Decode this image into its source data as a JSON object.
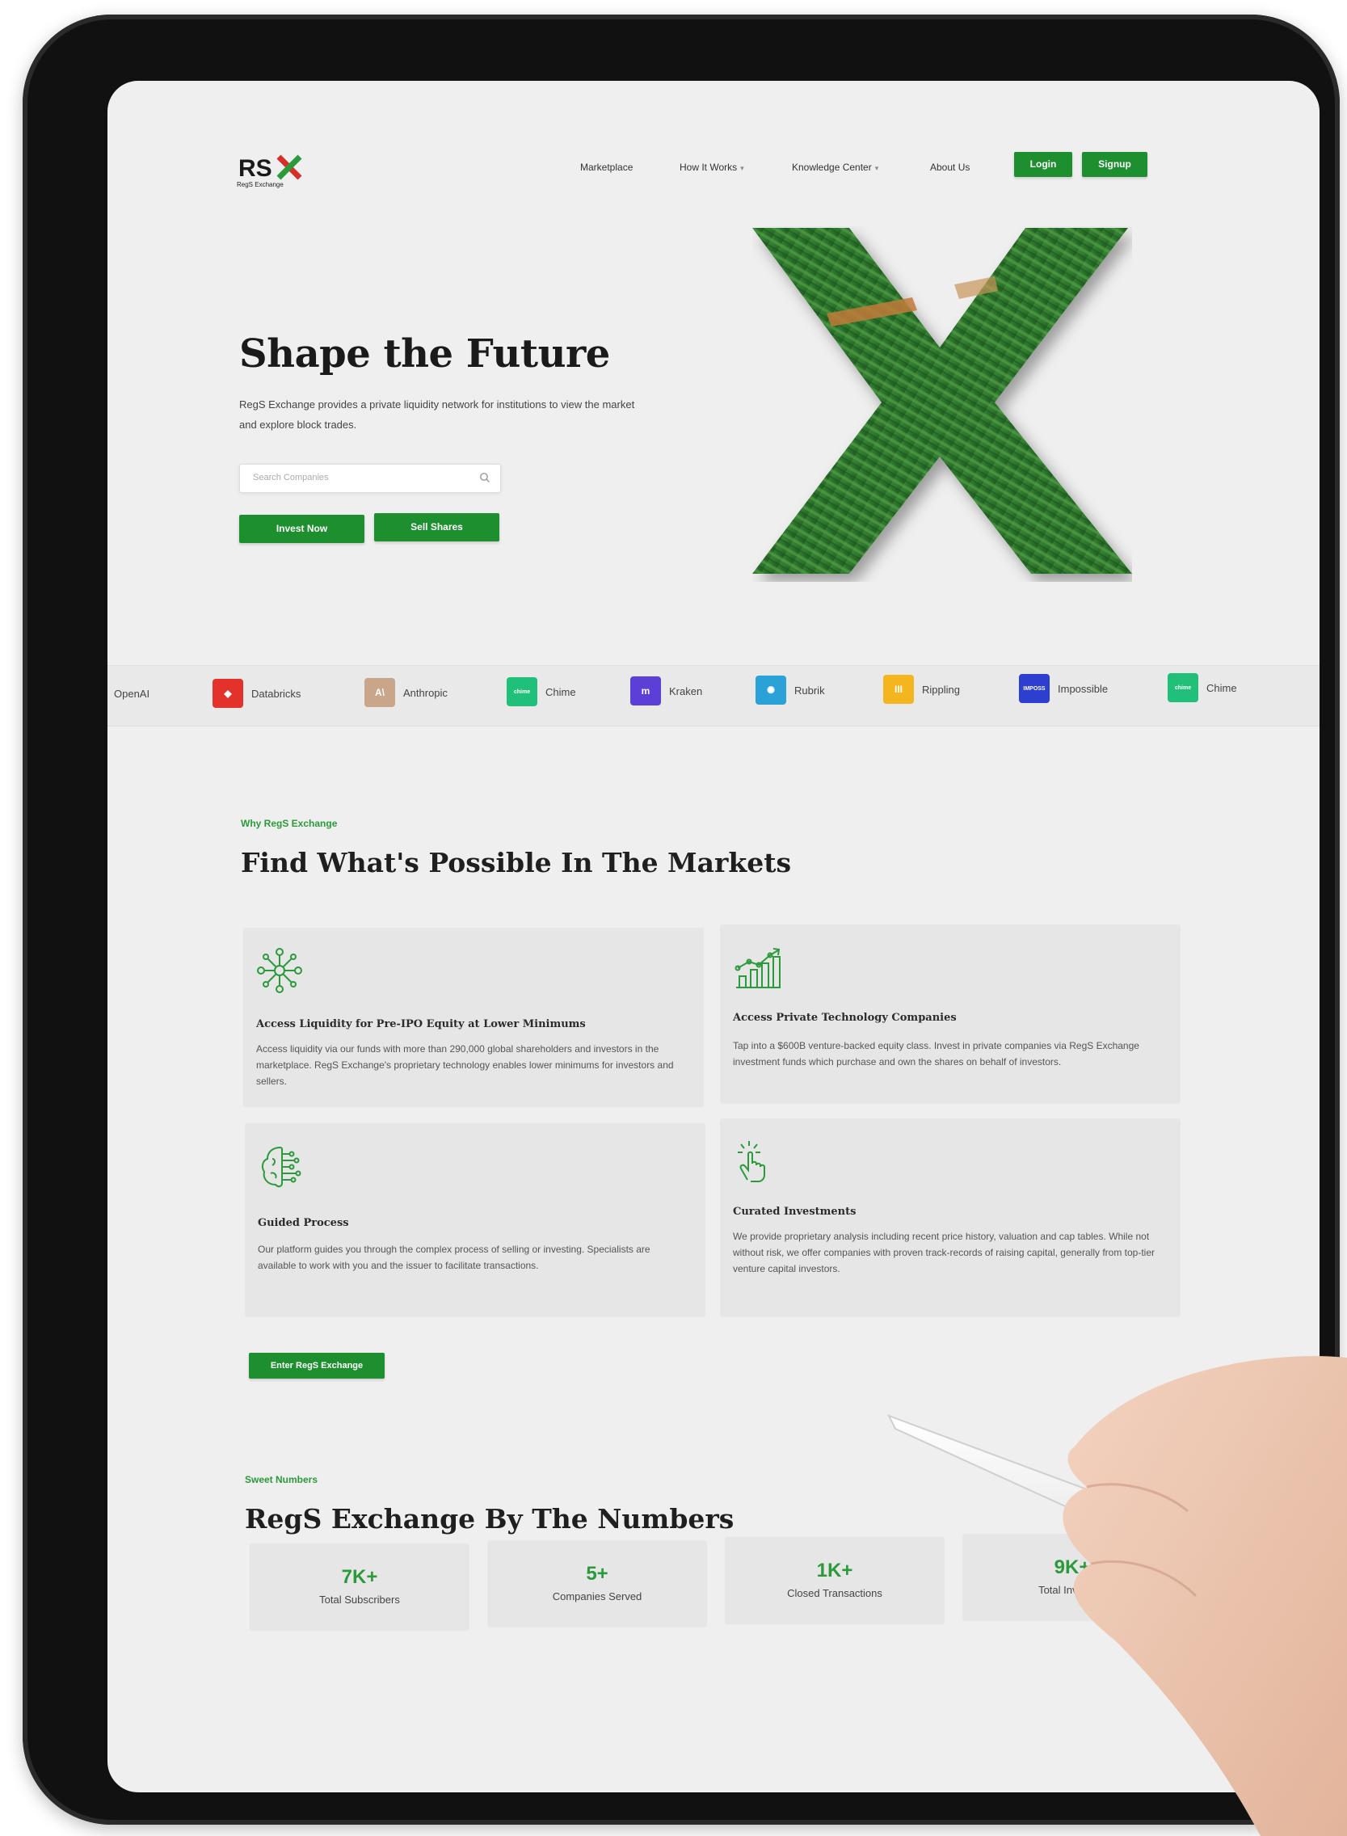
{
  "brand": {
    "logo_text": "RSX",
    "logo_subtitle": "RegS Exchange"
  },
  "nav": {
    "items": [
      "Marketplace",
      "How It Works",
      "Knowledge Center",
      "About Us"
    ],
    "login_label": "Login",
    "signup_label": "Signup"
  },
  "hero": {
    "title": "Shape the Future",
    "description": "RegS Exchange provides a private liquidity network for institutions to view the market and explore block trades.",
    "search_placeholder": "Search Companies",
    "invest_label": "Invest Now",
    "sell_label": "Sell Shares"
  },
  "companies": [
    {
      "name": "OpenAI",
      "badge": "",
      "color": "#e9e9e9"
    },
    {
      "name": "Databricks",
      "badge": "◆",
      "color": "#e2322b"
    },
    {
      "name": "Anthropic",
      "badge": "A\\",
      "color": "#c9a58a"
    },
    {
      "name": "Chime",
      "badge": "chime",
      "color": "#21c07a"
    },
    {
      "name": "Kraken",
      "badge": "m",
      "color": "#5b3fd6"
    },
    {
      "name": "Rubrik",
      "badge": "✺",
      "color": "#2aa2d8"
    },
    {
      "name": "Rippling",
      "badge": "III",
      "color": "#f5b51f"
    },
    {
      "name": "Impossible",
      "badge": "IMPOSS",
      "color": "#2c3fd1"
    },
    {
      "name": "Chime",
      "badge": "chime",
      "color": "#21c07a"
    }
  ],
  "why": {
    "eyebrow": "Why RegS Exchange",
    "title": "Find What's Possible In The Markets",
    "cards": [
      {
        "icon": "network-icon",
        "title": "Access Liquidity for Pre-IPO Equity at Lower Minimums",
        "body": "Access liquidity via our funds with more than 290,000 global shareholders and investors in the marketplace. RegS Exchange's proprietary technology enables lower minimums for investors and sellers."
      },
      {
        "icon": "growth-chart-icon",
        "title": "Access Private Technology Companies",
        "body": "Tap into a $600B venture-backed equity class. Invest in private companies via RegS Exchange investment funds which purchase and own the shares on behalf of investors."
      },
      {
        "icon": "brain-circuit-icon",
        "title": "Guided Process",
        "body": "Our platform guides you through the complex process of selling or investing. Specialists are available to work with you and the issuer to facilitate transactions."
      },
      {
        "icon": "tap-hand-icon",
        "title": "Curated Investments",
        "body": "We provide proprietary analysis including recent price history, valuation and cap tables. While not without risk, we offer companies with proven track-records of raising capital, generally from top-tier venture capital investors."
      }
    ],
    "cta_label": "Enter RegS Exchange"
  },
  "numbers": {
    "eyebrow": "Sweet Numbers",
    "title": "RegS Exchange By The Numbers",
    "stats": [
      {
        "value": "7K+",
        "label": "Total Subscribers"
      },
      {
        "value": "5+",
        "label": "Companies Served"
      },
      {
        "value": "1K+",
        "label": "Closed Transactions"
      },
      {
        "value": "9K+",
        "label": "Total Investors"
      }
    ]
  },
  "colors": {
    "accent": "#1d8f2f",
    "accent_text": "#2a9a3b",
    "screen_bg": "#efefef",
    "card_bg": "#e6e6e6"
  }
}
